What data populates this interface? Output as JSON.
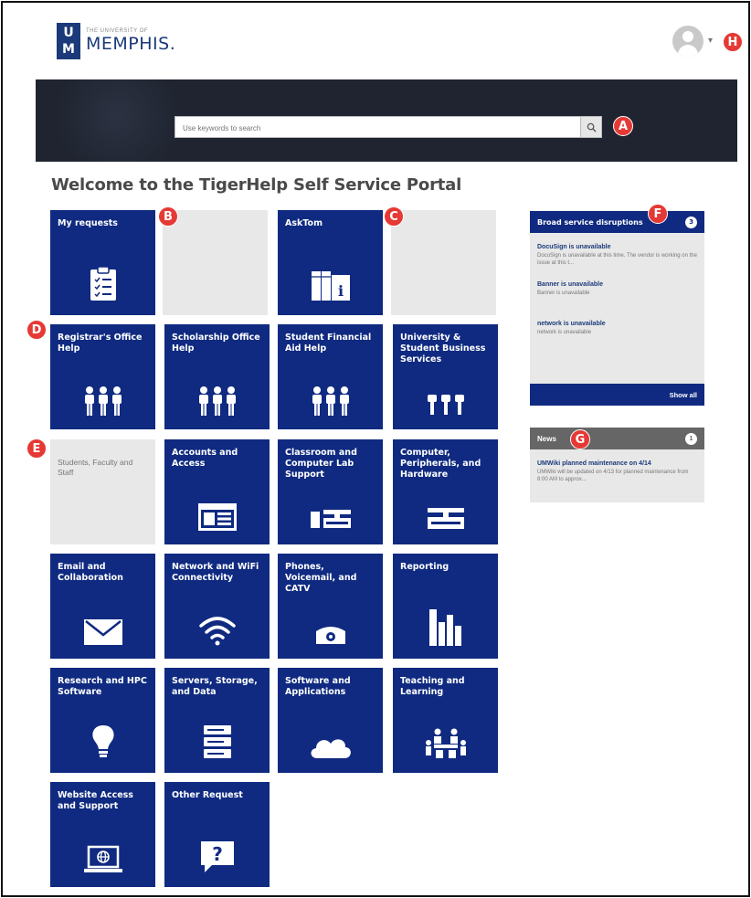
{
  "header": {
    "logo_mark_top": "U",
    "logo_mark_bottom": "M",
    "logo_small": "The University of",
    "logo_big": "MEMPHIS."
  },
  "search": {
    "placeholder": "Use keywords to search"
  },
  "page_title": "Welcome to the TigerHelp Self Service Portal",
  "tiles": {
    "my_requests": "My requests",
    "asktom": "AskTom",
    "registrar": "Registrar's Office Help",
    "scholarship": "Scholarship Office Help",
    "financial_aid": "Student Financial Aid Help",
    "business": "University & Student Business Services",
    "accounts": "Accounts and Access",
    "classroom": "Classroom and Computer Lab Support",
    "computer": "Computer, Peripherals, and Hardware",
    "email": "Email and Collaboration",
    "network": "Network and WiFi Connectivity",
    "phones": "Phones, Voicemail, and CATV",
    "reporting": "Reporting",
    "research": "Research and HPC Software",
    "servers": "Servers, Storage, and Data",
    "software": "Software and Applications",
    "teaching": "Teaching and Learning",
    "website": "Website Access and Support",
    "other": "Other Request"
  },
  "students_faculty_text": "Students, Faculty and Staff",
  "disruptions": {
    "title": "Broad service disruptions",
    "count": "3",
    "items": [
      {
        "title": "DocuSign is unavailable",
        "desc": "DocuSign is unavailable at this time. The vendor is working on the issue at this t..."
      },
      {
        "title": "Banner is unavailable",
        "desc": "Banner is unavailable"
      },
      {
        "title": "network is unavailable",
        "desc": "network is unavailable"
      }
    ],
    "show_all": "Show all"
  },
  "news": {
    "title": "News",
    "count": "1",
    "item_title": "UMWiki planned maintenance on 4/14",
    "item_desc": "UMWiki will be updated on 4/13 for planned maintenance from 8:00 AM to approx..."
  },
  "markers": {
    "a": "A",
    "b": "B",
    "c": "C",
    "d": "D",
    "e": "E",
    "f": "F",
    "g": "G",
    "h": "H"
  },
  "colors": {
    "tile_blue": "#0f2a80",
    "banner_dark": "#1f2430",
    "marker_red": "#e53935",
    "placeholder_gray": "#e8e8e8"
  }
}
